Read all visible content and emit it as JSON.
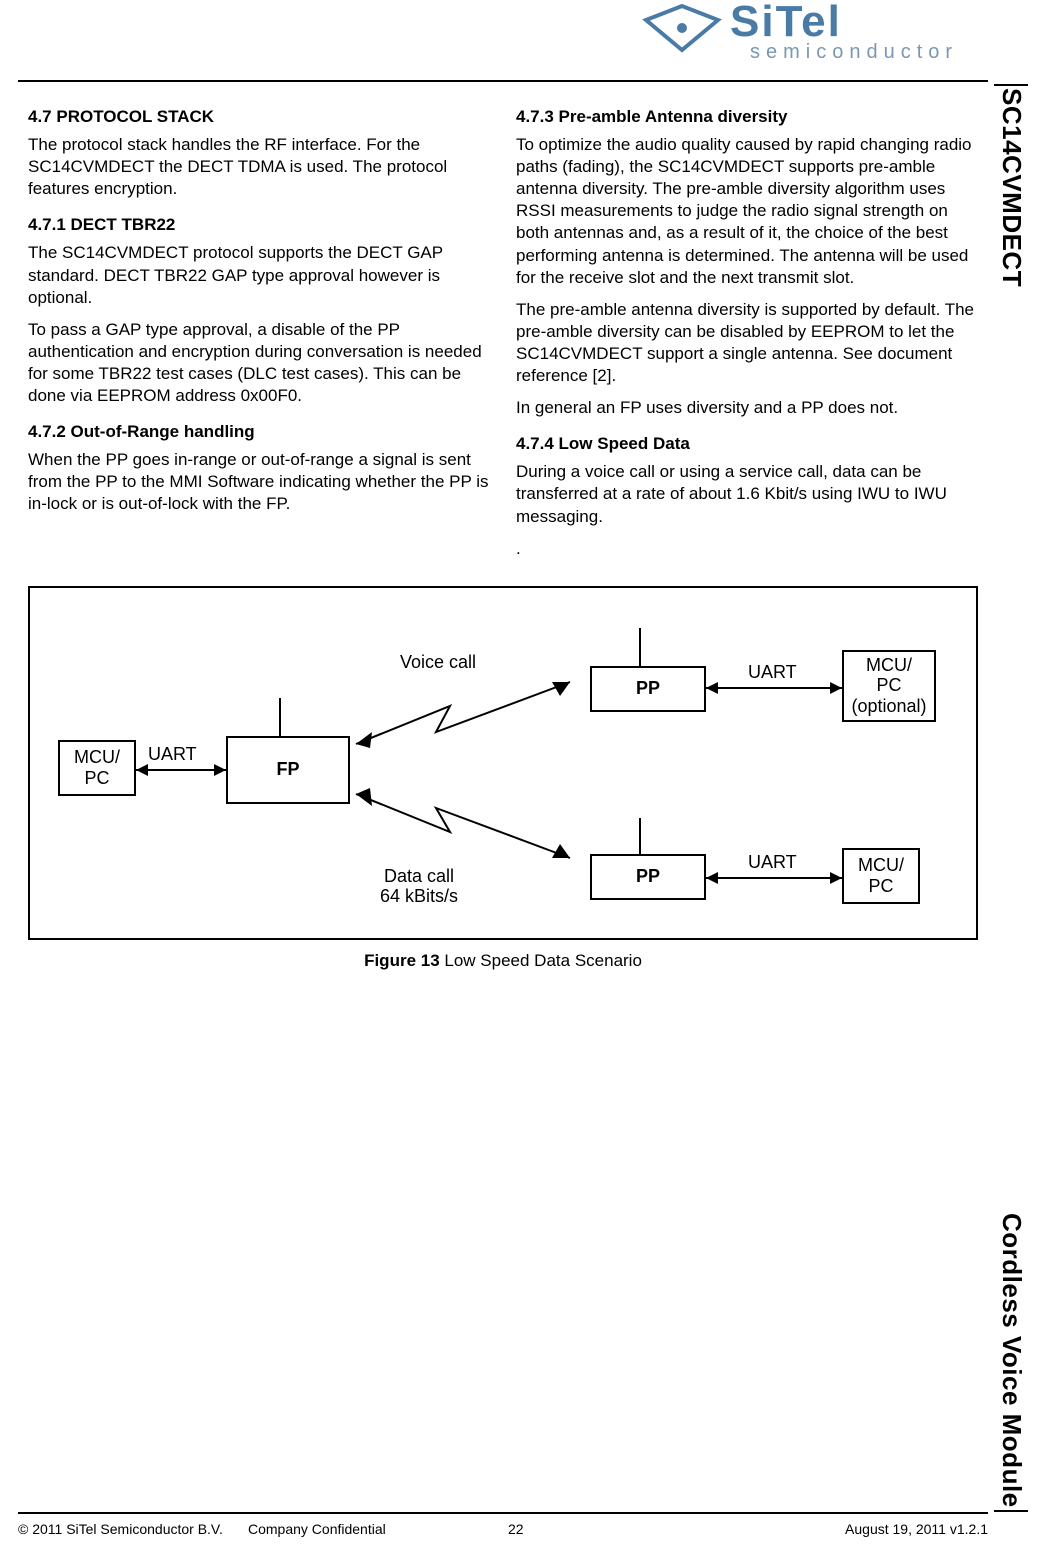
{
  "brand": {
    "name": "SiTel",
    "sub": "semiconductor"
  },
  "sidebar": {
    "top": "SC14CVMDECT",
    "bottom": "Cordless Voice Module"
  },
  "left": {
    "h47": "4.7    PROTOCOL STACK",
    "p47": "The protocol stack handles the RF interface. For the SC14CVMDECT the DECT TDMA is used. The protocol features encryption.",
    "h471": "4.7.1    DECT TBR22",
    "p471a": "The SC14CVMDECT protocol supports the DECT GAP standard. DECT TBR22 GAP type approval however is optional.",
    "p471b": "To pass a GAP type approval, a disable of the PP authentication and encryption during conversation is needed for some TBR22 test cases (DLC test cases). This can be done via EEPROM address 0x00F0.",
    "h472": "4.7.2    Out-of-Range handling",
    "p472": "When the PP goes in-range or out-of-range a signal is sent from the PP to the MMI Software indicating whether the PP is in-lock or is out-of-lock with the FP."
  },
  "right": {
    "h473": "4.7.3    Pre-amble Antenna diversity",
    "p473a": "To optimize the audio quality caused by rapid changing radio paths (fading), the SC14CVMDECT supports pre-amble antenna diversity. The pre-amble diversity algorithm uses RSSI measurements to judge the radio signal strength on both antennas and, as a result of it, the choice of the best performing antenna is determined. The antenna will be used for the receive slot and the next transmit slot.",
    "p473b": "The pre-amble antenna diversity is supported by default. The pre-amble diversity can be disabled by EEPROM to let the SC14CVMDECT support a single antenna. See document reference [2].",
    "p473c": "In general an FP uses diversity and a PP does not.",
    "h474": "4.7.4    Low Speed Data",
    "p474": "During a voice call or using a service call, data can be transferred at a rate of about 1.6 Kbit/s using IWU to IWU messaging.",
    "pdot": "."
  },
  "figure": {
    "caption_bold": "Figure 13",
    "caption_rest": "  Low Speed Data Scenario",
    "labels": {
      "mcu_pc": "MCU/\nPC",
      "mcu_pc_opt": "MCU/\nPC\n(optional)",
      "fp": "FP",
      "pp": "PP",
      "uart": "UART",
      "voice": "Voice call",
      "data": "Data call\n64 kBits/s"
    }
  },
  "footer": {
    "copyright": "© 2011 SiTel Semiconductor B.V.",
    "conf": "Company Confidential",
    "page": "22",
    "date": "August 19, 2011 v1.2.1"
  }
}
